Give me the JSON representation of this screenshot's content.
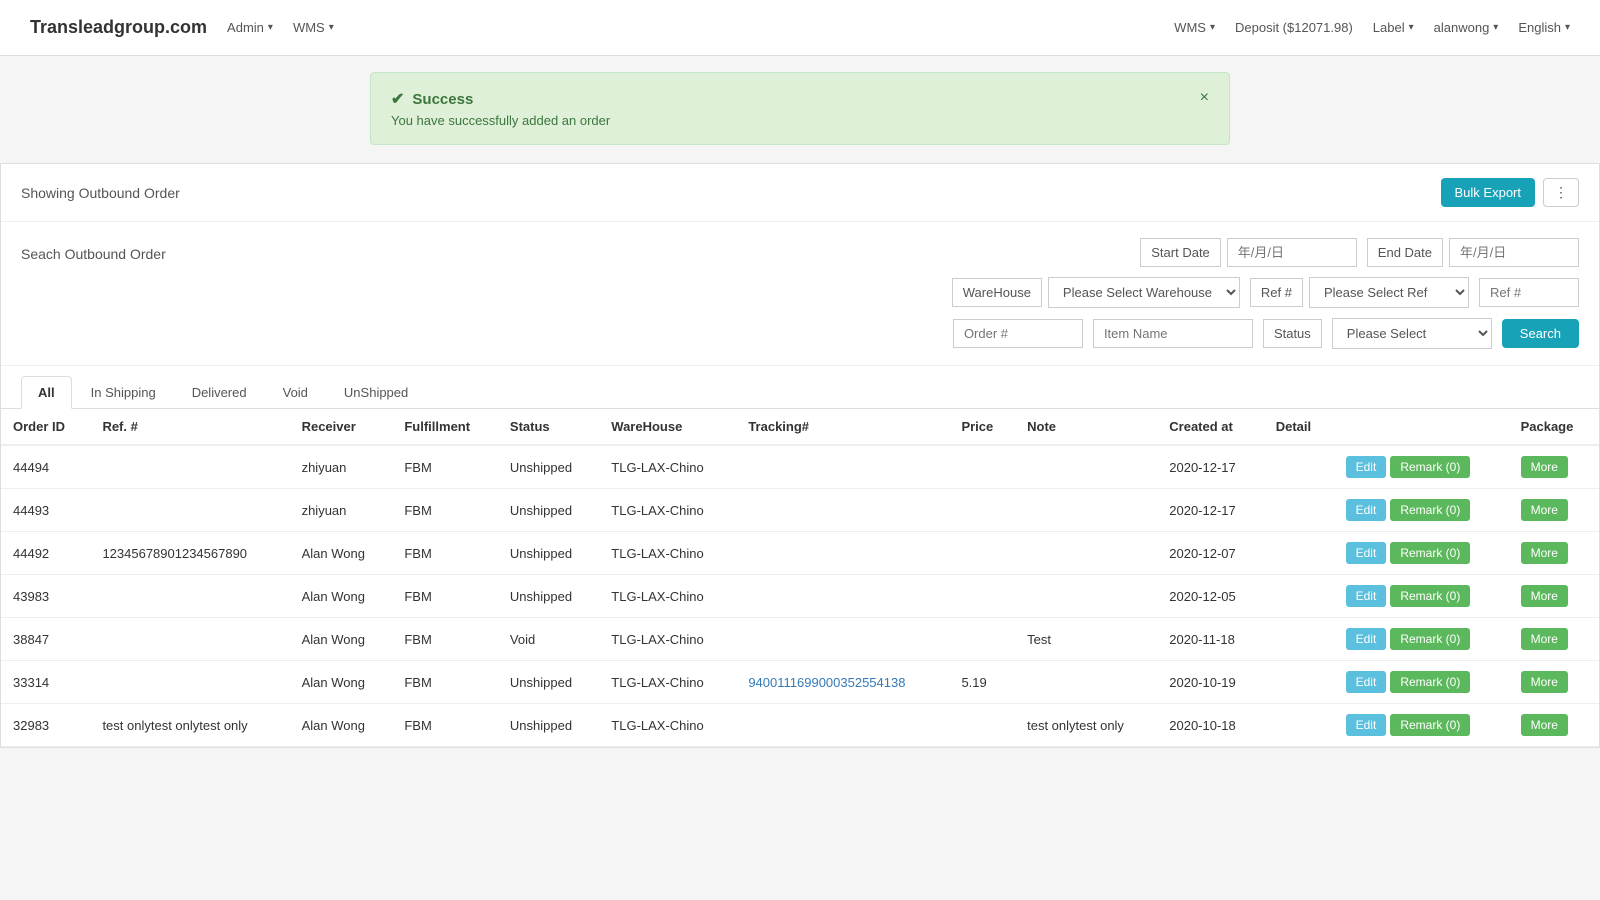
{
  "navbar": {
    "brand": "Transleadgroup.com",
    "left_items": [
      {
        "label": "Admin",
        "has_caret": true
      },
      {
        "label": "WMS",
        "has_caret": true
      }
    ],
    "right_items": [
      {
        "label": "WMS",
        "has_caret": true
      },
      {
        "label": "Deposit ($12071.98)",
        "has_caret": false
      },
      {
        "label": "Label",
        "has_caret": true
      },
      {
        "label": "alanwong",
        "has_caret": true
      },
      {
        "label": "English",
        "has_caret": true
      }
    ]
  },
  "alert": {
    "title": "Success",
    "message": "You have successfully added an order",
    "close_symbol": "×"
  },
  "topbar": {
    "title": "Showing Outbound Order",
    "bulk_export_label": "Bulk Export",
    "dots_label": "⋮"
  },
  "search": {
    "label": "Seach Outbound Order",
    "start_date_label": "Start Date",
    "start_date_placeholder": "年/月/日",
    "end_date_label": "End Date",
    "end_date_placeholder": "年/月/日",
    "warehouse_label": "WareHouse",
    "warehouse_placeholder": "Please Select Warehouse",
    "ref_label": "Ref #",
    "ref_placeholder": "Please Select Ref",
    "ref_input_placeholder": "Ref #",
    "order_placeholder": "Order #",
    "item_placeholder": "Item Name",
    "status_label": "Status",
    "status_placeholder": "Please Select",
    "search_btn": "Search"
  },
  "tabs": [
    {
      "label": "All",
      "active": true
    },
    {
      "label": "In Shipping",
      "active": false
    },
    {
      "label": "Delivered",
      "active": false
    },
    {
      "label": "Void",
      "active": false
    },
    {
      "label": "UnShipped",
      "active": false
    }
  ],
  "table": {
    "headers": [
      "Order ID",
      "Ref. #",
      "Receiver",
      "Fulfillment",
      "Status",
      "WareHouse",
      "Tracking#",
      "Price",
      "Note",
      "Created at",
      "Detail",
      "",
      "Package"
    ],
    "rows": [
      {
        "order_id": "44494",
        "ref": "",
        "receiver": "zhiyuan",
        "fulfillment": "FBM",
        "status": "Unshipped",
        "warehouse": "TLG-LAX-Chino",
        "tracking": "",
        "tracking_link": false,
        "price": "",
        "note": "",
        "created_at": "2020-12-17",
        "edit_label": "Edit",
        "remark_label": "Remark (0)",
        "more_label": "More"
      },
      {
        "order_id": "44493",
        "ref": "",
        "receiver": "zhiyuan",
        "fulfillment": "FBM",
        "status": "Unshipped",
        "warehouse": "TLG-LAX-Chino",
        "tracking": "",
        "tracking_link": false,
        "price": "",
        "note": "",
        "created_at": "2020-12-17",
        "edit_label": "Edit",
        "remark_label": "Remark (0)",
        "more_label": "More"
      },
      {
        "order_id": "44492",
        "ref": "12345678901234567890",
        "receiver": "Alan Wong",
        "fulfillment": "FBM",
        "status": "Unshipped",
        "warehouse": "TLG-LAX-Chino",
        "tracking": "",
        "tracking_link": false,
        "price": "",
        "note": "",
        "created_at": "2020-12-07",
        "edit_label": "Edit",
        "remark_label": "Remark (0)",
        "more_label": "More"
      },
      {
        "order_id": "43983",
        "ref": "",
        "receiver": "Alan Wong",
        "fulfillment": "FBM",
        "status": "Unshipped",
        "warehouse": "TLG-LAX-Chino",
        "tracking": "",
        "tracking_link": false,
        "price": "",
        "note": "",
        "created_at": "2020-12-05",
        "edit_label": "Edit",
        "remark_label": "Remark (0)",
        "more_label": "More"
      },
      {
        "order_id": "38847",
        "ref": "",
        "receiver": "Alan Wong",
        "fulfillment": "FBM",
        "status": "Void",
        "warehouse": "TLG-LAX-Chino",
        "tracking": "",
        "tracking_link": false,
        "price": "",
        "note": "Test",
        "created_at": "2020-11-18",
        "edit_label": "Edit",
        "remark_label": "Remark (0)",
        "more_label": "More"
      },
      {
        "order_id": "33314",
        "ref": "",
        "receiver": "Alan Wong",
        "fulfillment": "FBM",
        "status": "Unshipped",
        "warehouse": "TLG-LAX-Chino",
        "tracking": "9400111699000352554138",
        "tracking_link": true,
        "price": "5.19",
        "note": "",
        "created_at": "2020-10-19",
        "edit_label": "Edit",
        "remark_label": "Remark (0)",
        "more_label": "More"
      },
      {
        "order_id": "32983",
        "ref": "test onlytest onlytest only",
        "receiver": "Alan Wong",
        "fulfillment": "FBM",
        "status": "Unshipped",
        "warehouse": "TLG-LAX-Chino",
        "tracking": "",
        "tracking_link": false,
        "price": "",
        "note": "test onlytest only",
        "created_at": "2020-10-18",
        "edit_label": "Edit",
        "remark_label": "Remark (0)",
        "more_label": "More"
      }
    ]
  }
}
